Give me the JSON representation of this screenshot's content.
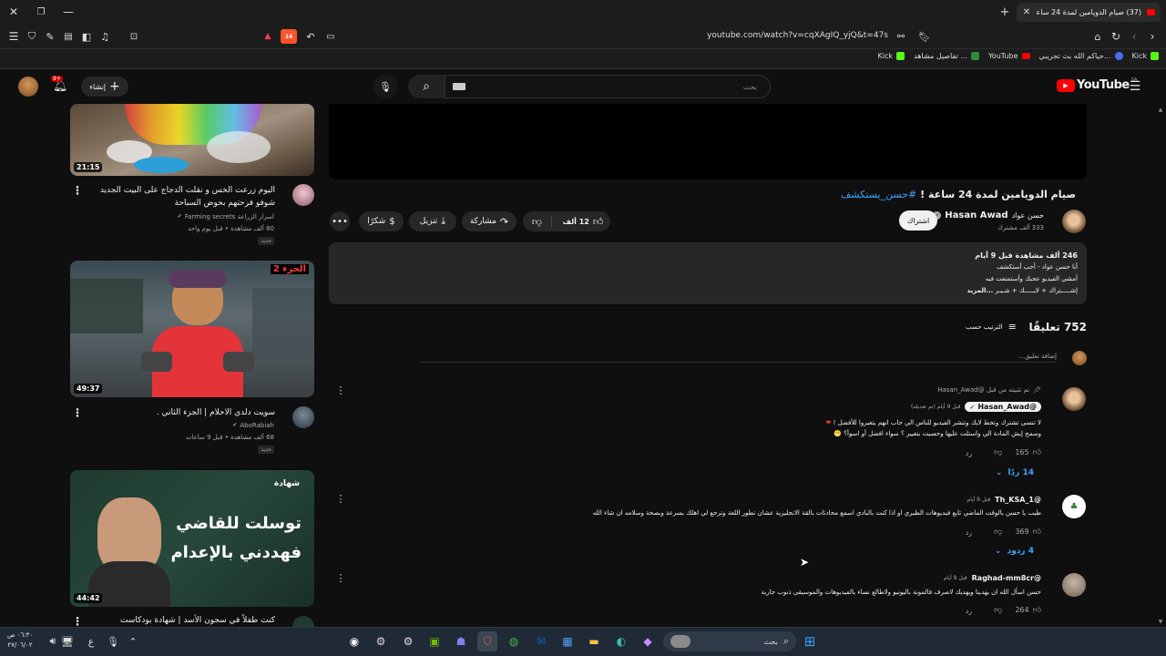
{
  "browser": {
    "tab_title": "(37) صيام الدويامين لمدة 24 ساعة",
    "url": "youtube.com/watch?v=cqXAgIQ_yjQ&t=47s",
    "bookmarks": [
      {
        "label": "Kick",
        "color": "#53fc18"
      },
      {
        "label": "حياكم الله بث تجريبي...",
        "color": "#4a6cf7"
      },
      {
        "label": "YouTube",
        "color": "#ff0000"
      },
      {
        "label": "تفاصيل مشاهد ...",
        "color": "#2d8c3c"
      },
      {
        "label": "Kick",
        "color": "#53fc18"
      }
    ],
    "shield_count": "14"
  },
  "yt": {
    "logo": "YouTube",
    "region": "SA",
    "search_placeholder": "بحث",
    "create_label": "إنشاء",
    "notif_count": "9+"
  },
  "video": {
    "title_hashtag": "#حسن_يستكشف",
    "title": "صيام الدويامين لمدة 24 ساعة !",
    "channel": "Hasan Awad",
    "channel_ar": "حسن عواد",
    "subscribers": "333 ألف مشترك",
    "subscribe": "اشتراك",
    "likes": "12 ألف",
    "share": "مشاركة",
    "download": "تنزيل",
    "thanks": "شكرًا"
  },
  "description": {
    "stats": "246 ألف مشاهدة  قبل 9 أيام",
    "line1": "أنا حسن عواد - أحب أستكشف",
    "line2": "أمشي الفيديو عجبك وأستمتعت فيه",
    "line3": "إشـــــتراك + لايـــــك + شـيـر",
    "more": "...المزيد"
  },
  "comments_header": {
    "count": "752 تعليقًا",
    "sort": "الترتيب حسب",
    "add_placeholder": "إضافة تعليق..."
  },
  "comments": [
    {
      "pinned": "تم تثبيته من قبل @Hasan_Awad",
      "author": "@Hasan_Awad",
      "time": "قبل 9 أيام (تم تعديله)",
      "line1": "لا تنسى تشترك وتحط لايك وتنشر الفيديو للناس الي حاب انهم يتغيروا للأفضل !",
      "line2": "وسمح إيش المادة الي واستلت عليها وحسيت بتغيير ؟ سواء افضل أو اسوأ؟",
      "likes": "165",
      "reply": "رد",
      "replies": "14 ردًا"
    },
    {
      "author": "@Th_KSA_1",
      "time": "قبل 9 أيام",
      "line1": "طيب يا حسن بالوقت الماضي تابع فيديوهات الطيري او اذا كنت بالبادي اسمع محادثات بالقة الانجليزية عشان تطور اللغة وترجع لي اهلك بسرعة وبصحة وسلامه ان شاء الله",
      "likes": "369",
      "reply": "رد",
      "replies": "4 ردود"
    },
    {
      "author": "@Raghad-mm8cr",
      "time": "قبل 9 أيام",
      "line1": "حسن اسأل الله ان يهدينا ويهديك لاصرف فالمونة باليوتيو ولاطالع نساء بالفيديوهات والموسيقى ذنوب جارية",
      "likes": "264",
      "reply": "رد"
    }
  ],
  "sidebar_videos": [
    {
      "title": "اليوم زرعت الخس و نقلت الدجاج على البيت الجديد شوفو فرحتهم بحوض السباحة",
      "channel": "اسرار الزراعة Farming secrets",
      "meta": "80 ألف مشاهدة • قبل يوم واحد",
      "badge": "جديد",
      "duration": "21:15"
    },
    {
      "title": "سويت دلدي الاحلام | الجزء الثاني .",
      "channel": "AboRabiah",
      "meta": "68 ألف مشاهدة • قبل 9 ساعات",
      "badge": "جديد",
      "duration": "49:37",
      "thumb_label": "الجزء 2"
    },
    {
      "title": "كنت طفلاً في سجون الأسد | شهادة بودكاست",
      "duration": "44:42",
      "thumb_line1": "توسلت للقاضي",
      "thumb_line2": "فهددني بالإعدام",
      "thumb_brand": "شهادة"
    }
  ],
  "taskbar": {
    "search": "بحث",
    "time": "٠٦:٣٠ ص",
    "date": "٢٧/٠٦/٠٢",
    "lang": "ع"
  }
}
